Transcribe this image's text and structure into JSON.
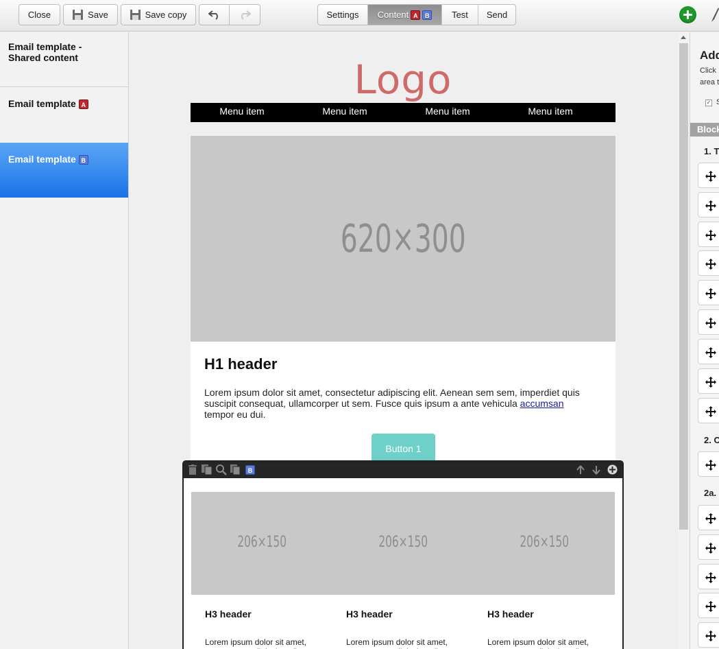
{
  "toolbar": {
    "close_label": "Close",
    "save_label": "Save",
    "save_copy_label": "Save copy",
    "tabs": [
      {
        "label": "Settings",
        "active": false
      },
      {
        "label": "Content",
        "active": true,
        "badges": [
          "A",
          "B"
        ]
      },
      {
        "label": "Test",
        "active": false
      },
      {
        "label": "Send",
        "active": false
      }
    ]
  },
  "sidebar": {
    "items": [
      {
        "label_line1": "Email template -",
        "label_line2": "Shared content",
        "selected": false
      },
      {
        "label": "Email template",
        "badge": "A",
        "selected": false
      },
      {
        "label": "Email template",
        "badge": "B",
        "selected": true
      }
    ]
  },
  "email": {
    "logo": "Logo",
    "menu": [
      "Menu item",
      "Menu item",
      "Menu item",
      "Menu item"
    ],
    "hero_placeholder": "620×300",
    "h1": "H1 header",
    "paragraph_text": "Lorem ipsum dolor sit amet, consectetur adipiscing elit. Aenean sem sem, imperdiet quis suscipit consequat, ullamcorper ut sem. Fusce quis ipsum a ante vehicula ",
    "paragraph_link": "accumsan",
    "paragraph_tail": " tempor eu dui.",
    "button_label": "Button 1",
    "block_badge": "B",
    "columns": [
      {
        "placeholder": "206×150",
        "h3": "H3 header",
        "text": "Lorem ipsum dolor sit amet, consectetur adipiscing elit."
      },
      {
        "placeholder": "206×150",
        "h3": "H3 header",
        "text": "Lorem ipsum dolor sit amet, consectetur adipiscing elit."
      },
      {
        "placeholder": "206×150",
        "h3": "H3 header",
        "text": "Lorem ipsum dolor sit amet, consectetur adipiscing elit."
      }
    ]
  },
  "right_panel": {
    "title": "Add",
    "subtitle_line1": "Click",
    "subtitle_line2": "area t",
    "checkbox_label": "S",
    "blocks_header": "Block",
    "section1": "1. T",
    "section2": "2. C",
    "section3": "2a."
  },
  "colors": {
    "accent_blue": "#1a72e8",
    "logo": "#cd6b6b",
    "button": "#6fcfc9",
    "badge_a": "#c0262e",
    "badge_b": "#5c7bd6",
    "add_green": "#1d9a2c"
  }
}
